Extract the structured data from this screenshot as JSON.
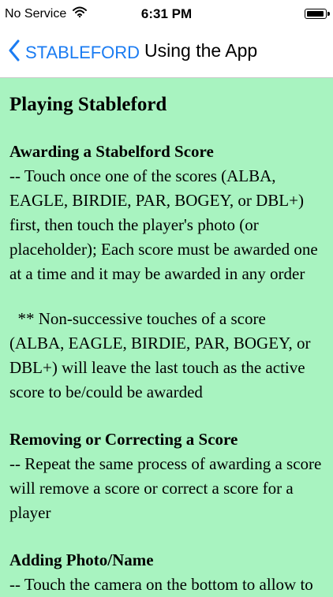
{
  "status_bar": {
    "carrier": "No Service",
    "time": "6:31 PM"
  },
  "nav": {
    "back_label": "STABLEFORD",
    "title": "Using the App"
  },
  "content": {
    "main_heading": "Playing Stableford",
    "sections": [
      {
        "heading": "Awarding a Stabelford Score",
        "lines": [
          "-- Touch once one of the scores (ALBA,",
          "EAGLE, BIRDIE, PAR, BOGEY, or DBL+)",
          "first, then touch the player's photo (or",
          "placeholder); Each score must be awarded one",
          "at a time and it may be awarded in any order"
        ]
      },
      {
        "heading": "",
        "lines": [
          "  ** Non-successive touches of a score",
          "(ALBA, EAGLE, BIRDIE, PAR, BOGEY, or",
          "DBL+) will leave the last touch as the active",
          "score to be/could be awarded"
        ]
      },
      {
        "heading": "Removing or Correcting a Score",
        "lines": [
          "-- Repeat the same process of awarding a score",
          "will remove a score or correct a score for a",
          "player"
        ]
      },
      {
        "heading": "Adding Photo/Name",
        "lines": [
          "-- Touch the camera on the bottom to allow to"
        ]
      }
    ]
  },
  "colors": {
    "background": "#a8f3c0",
    "accent": "#1b7cf2"
  },
  "icons": {
    "wifi": "wifi-icon",
    "battery": "battery-icon",
    "back": "chevron-left-icon"
  }
}
